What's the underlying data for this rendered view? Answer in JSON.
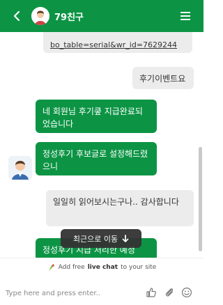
{
  "colors": {
    "accent": "#0c9444",
    "user_bubble": "#ececec"
  },
  "header": {
    "back_icon": "chevron-left-icon",
    "title": "79친구",
    "menu_icon": "hamburger-icon"
  },
  "messages": [
    {
      "from": "user",
      "text": "bo_table=serial&wr_id=7629244"
    },
    {
      "from": "user",
      "text": "후기이벤트요"
    },
    {
      "from": "agent",
      "text": "네 회원님 후기쿺 지급완료되었습니다"
    },
    {
      "from": "agent",
      "text": "정성후기 후보글로 설정해드렸으니"
    },
    {
      "from": "user",
      "text": "일일히 읽어보시는구나.. 감사합니다"
    },
    {
      "from": "agent",
      "text": "정성후기 지급 처리한 예정"
    }
  ],
  "jump_button": {
    "label": "최근으로 이동",
    "icon": "arrow-down-icon"
  },
  "footer": {
    "powered_prefix": "Add free",
    "powered_bold": "live chat",
    "powered_suffix": "to your site"
  },
  "composer": {
    "placeholder": "Type here and press enter..",
    "icons": [
      "thumbs-up-icon",
      "paperclip-icon",
      "smiley-icon"
    ]
  }
}
